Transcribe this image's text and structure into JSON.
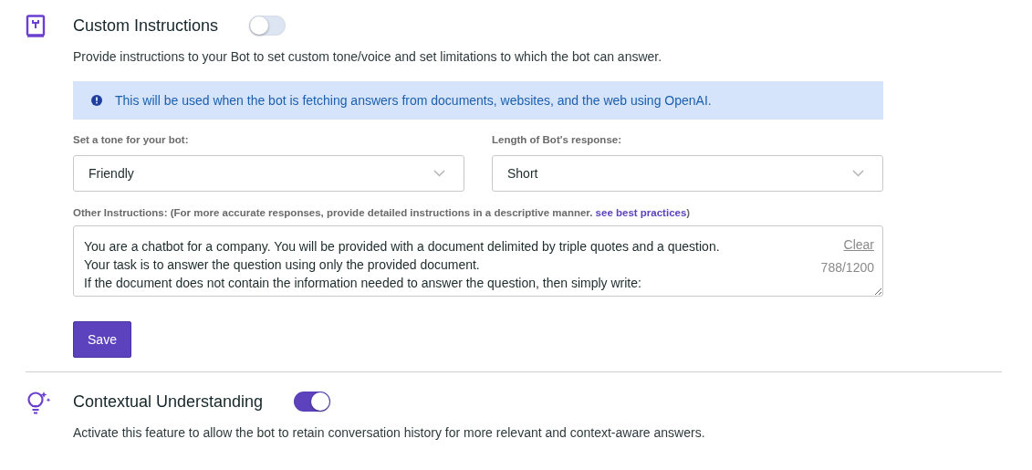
{
  "sections": [
    {
      "kind": "instructions",
      "title": "Custom Instructions",
      "on": false,
      "description": "Provide instructions to your Bot to set custom tone/voice and set limitations to which the bot can answer.",
      "notice": "This will be used when the bot is fetching answers from documents, websites, and the web using OpenAI.",
      "selects": [
        {
          "label": "Set a tone for your bot:",
          "value": "Friendly"
        },
        {
          "label": "Length of Bot's response:",
          "value": "Short"
        }
      ],
      "other_label": "Other Instructions: (For more accurate responses, provide detailed instructions in a descriptive manner.",
      "other_link": "see best practices",
      "other_suffix": ")",
      "instructions_value": "You are a chatbot for a company. You will be provided with a document delimited by triple quotes and a question.\nYour task is to answer the question using only the provided document.\nIf the document does not contain the information needed to answer the question, then simply write:",
      "clear": "Clear",
      "count": "788/1200",
      "save": "Save"
    },
    {
      "kind": "context",
      "title": "Contextual Understanding",
      "on": true,
      "description": "Activate this feature to allow the bot to retain conversation history for more relevant and context-aware answers."
    }
  ]
}
